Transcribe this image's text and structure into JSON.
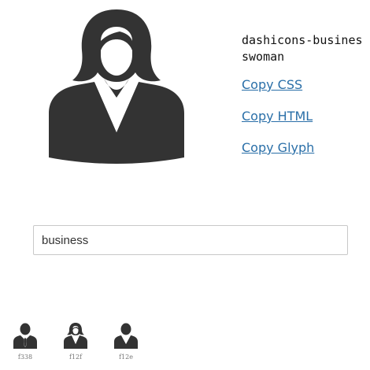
{
  "preview": {
    "icon": "businesswoman-icon",
    "icon_name": "dashicons-businesswoman"
  },
  "actions": {
    "copy_css": "Copy CSS",
    "copy_html": "Copy HTML",
    "copy_glyph": "Copy Glyph"
  },
  "search": {
    "value": "business",
    "placeholder": ""
  },
  "results": [
    {
      "code": "f338",
      "icon": "businessman-icon"
    },
    {
      "code": "f12f",
      "icon": "businesswoman-icon"
    },
    {
      "code": "f12e",
      "icon": "businessperson-icon"
    }
  ],
  "colors": {
    "icon": "#333333",
    "link": "#2a6fa8",
    "input_border": "#c8c8c8"
  }
}
